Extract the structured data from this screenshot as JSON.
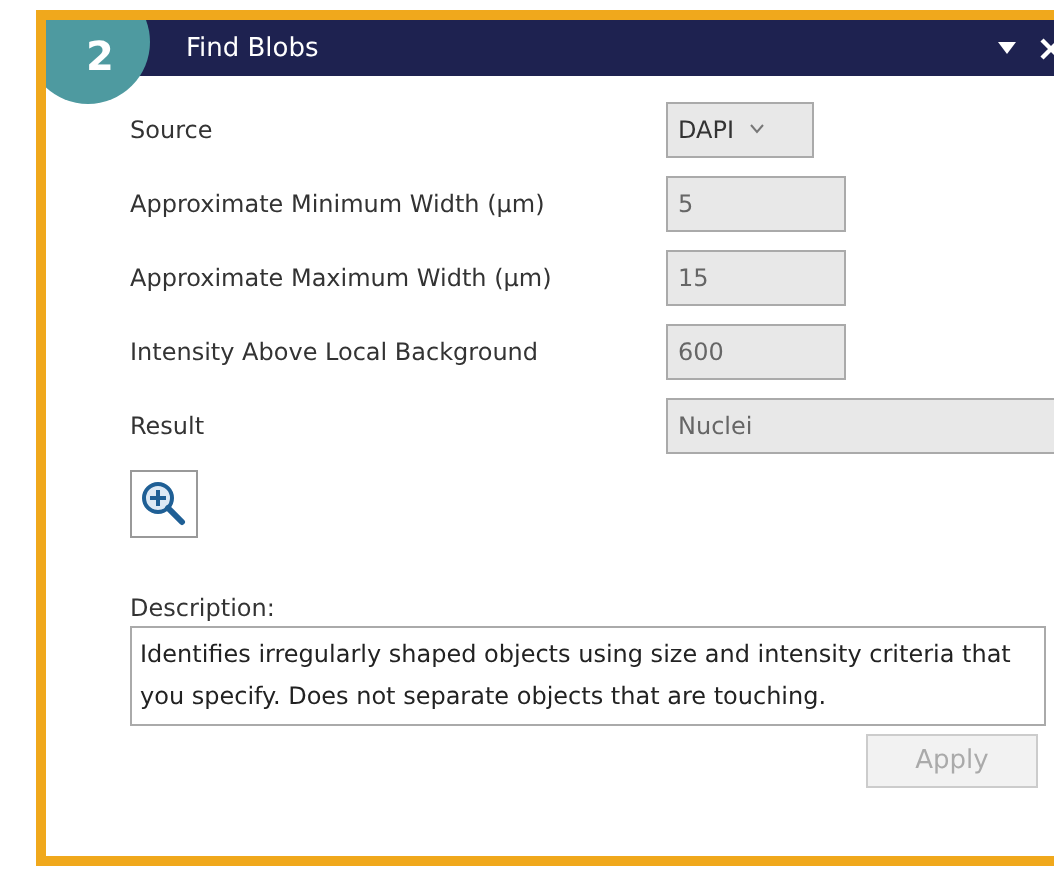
{
  "panel": {
    "step": "2",
    "title": "Find Blobs"
  },
  "fields": [
    {
      "kind": "dropdown",
      "label": "Source",
      "value": "DAPI",
      "disabled": false
    },
    {
      "kind": "input",
      "label": "Approximate Minimum Width (µm)",
      "value": "5",
      "disabled": true
    },
    {
      "kind": "input",
      "label": "Approximate Maximum Width (µm)",
      "value": "15",
      "disabled": true
    },
    {
      "kind": "input",
      "label": "Intensity Above Local Background",
      "value": "600",
      "disabled": true
    },
    {
      "kind": "wide",
      "label": "Result",
      "value": "Nuclei",
      "disabled": true
    }
  ],
  "description": {
    "label": "Description:",
    "text": "Identifies irregularly shaped objects using size and intensity criteria that you specify.  Does not separate objects that are touching."
  },
  "apply_button": {
    "label": "Apply",
    "disabled": true
  }
}
